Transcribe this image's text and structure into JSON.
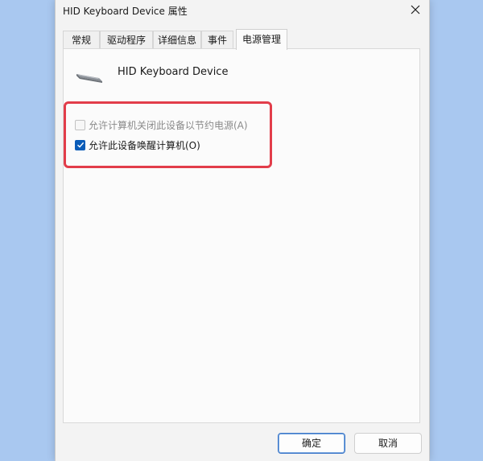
{
  "window": {
    "title": "HID Keyboard Device 属性",
    "close_symbol": "✕"
  },
  "tabs": [
    {
      "label": "常规",
      "active": false
    },
    {
      "label": "驱动程序",
      "active": false
    },
    {
      "label": "详细信息",
      "active": false
    },
    {
      "label": "事件",
      "active": false
    },
    {
      "label": "电源管理",
      "active": true
    }
  ],
  "device": {
    "name": "HID Keyboard Device",
    "icon": "keyboard-icon"
  },
  "options": [
    {
      "label": "允许计算机关闭此设备以节约电源(A)",
      "checked": false,
      "enabled": false
    },
    {
      "label": "允许此设备唤醒计算机(O)",
      "checked": true,
      "enabled": true
    }
  ],
  "buttons": {
    "ok": "确定",
    "cancel": "取消"
  },
  "colors": {
    "accent": "#0a5cb8",
    "highlight_border": "#e23d4a",
    "desktop": "#a9c8f0"
  }
}
